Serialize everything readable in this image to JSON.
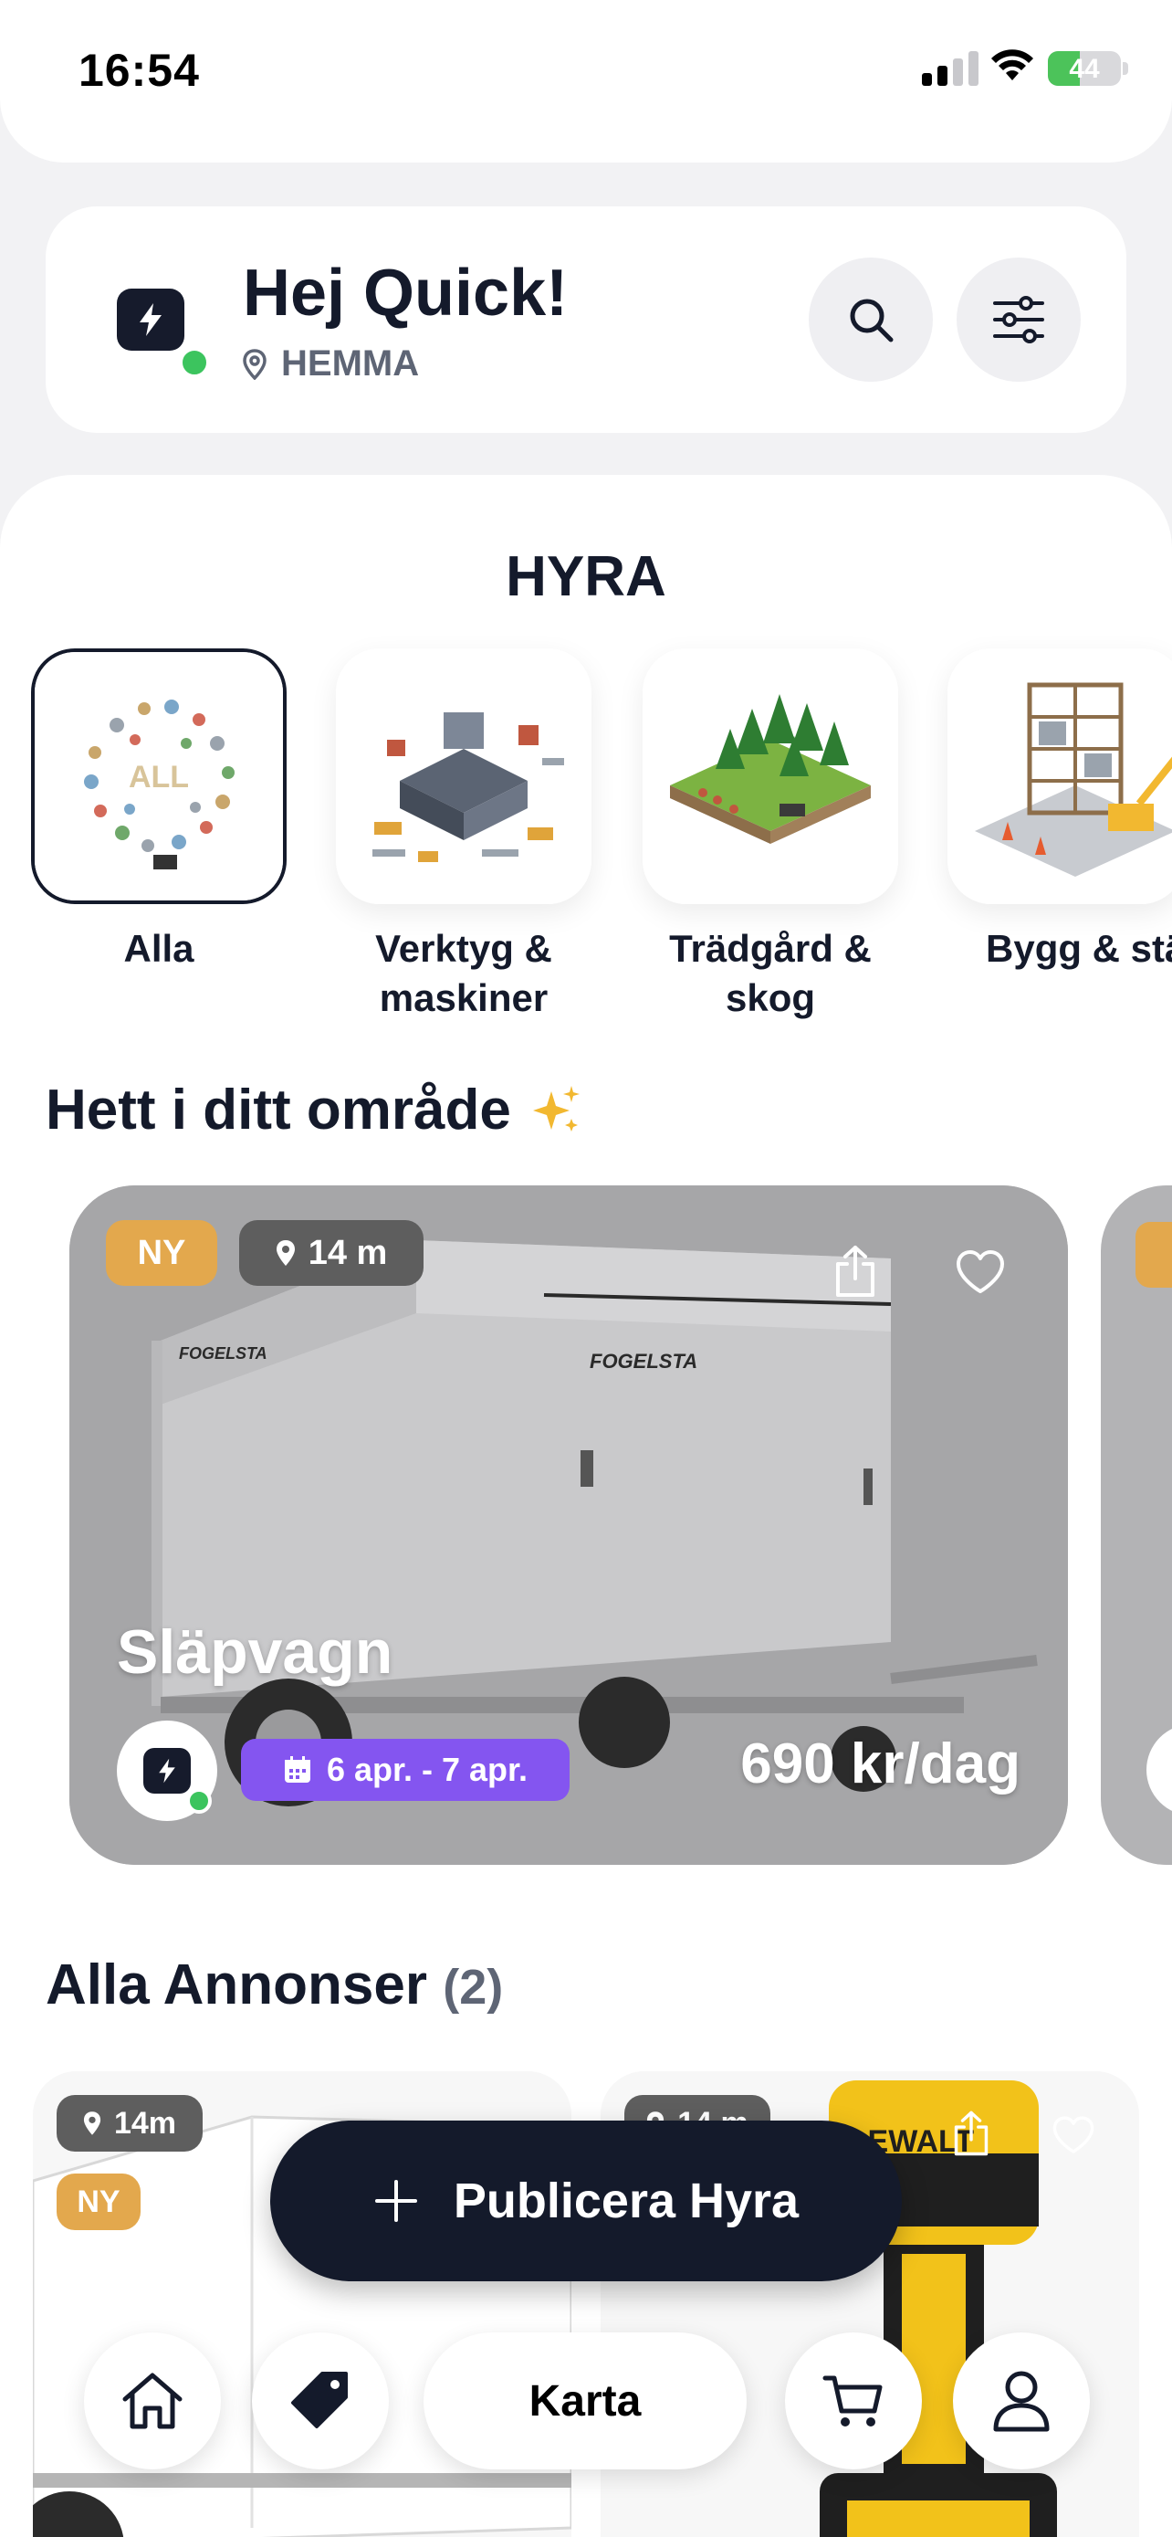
{
  "status_bar": {
    "time": "16:54",
    "battery": "44",
    "battery_level": 0.44
  },
  "header": {
    "greeting": "Hej Quick!",
    "location": "HEMMA"
  },
  "section_title": "HYRA",
  "categories": [
    {
      "label": "Alla",
      "icon": "all-categories-icon",
      "selected": true
    },
    {
      "label": "Verktyg & maskiner",
      "icon": "tools-machines-icon",
      "selected": false
    },
    {
      "label": "Trädgård & skog",
      "icon": "garden-forest-icon",
      "selected": false
    },
    {
      "label": "Bygg & ställning",
      "icon": "construction-scaffold-icon",
      "selected": false
    }
  ],
  "hot": {
    "title": "Hett i ditt område",
    "featured": {
      "badge": "NY",
      "distance": "14 m",
      "title": "Släpvagn",
      "dates": "6 apr. - 7 apr.",
      "price": "690 kr/dag",
      "brand_text": "FOGELSTA"
    }
  },
  "all_listings": {
    "title": "Alla Annonser",
    "count": "(2)",
    "items": [
      {
        "distance": "14m",
        "badge": "NY"
      },
      {
        "distance": "14 m",
        "brand_text": "DEWALT"
      }
    ]
  },
  "publish_button": {
    "label": "Publicera Hyra"
  },
  "bottom_nav": {
    "map_label": "Karta"
  },
  "colors": {
    "accent": "#141a2b",
    "online": "#3cc45e",
    "new_badge": "#e3a84d",
    "date_badge": "#8455f0"
  }
}
